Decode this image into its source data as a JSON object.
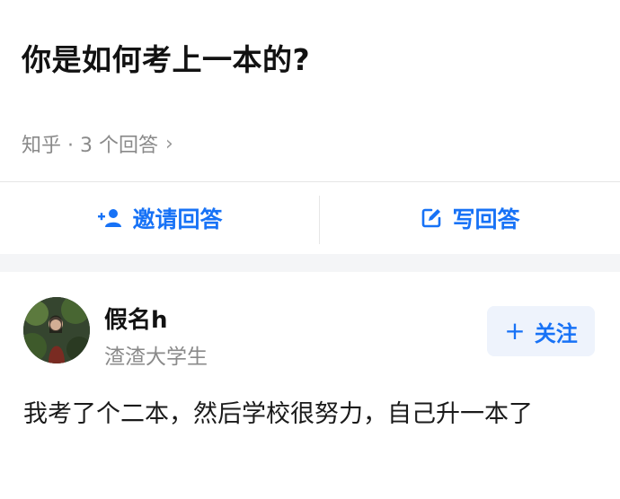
{
  "question": {
    "title": "你是如何考上一本的?",
    "meta": "知乎 · 3 个回答",
    "meta_chevron_icon": "chevron-right-icon"
  },
  "actions": {
    "invite_label": "邀请回答",
    "invite_icon": "add-person-icon",
    "write_label": "写回答",
    "write_icon": "edit-icon"
  },
  "answer": {
    "author_name": "假名h",
    "author_bio": "渣渣大学生",
    "follow_label": "关注",
    "follow_icon": "plus-icon",
    "content": "我考了个二本，然后学校很努力，自己升一本了"
  },
  "colors": {
    "accent": "#1772f6",
    "follow_bg": "#eef3fc",
    "muted_text": "#8a8a8a",
    "separator": "#f4f5f7"
  }
}
